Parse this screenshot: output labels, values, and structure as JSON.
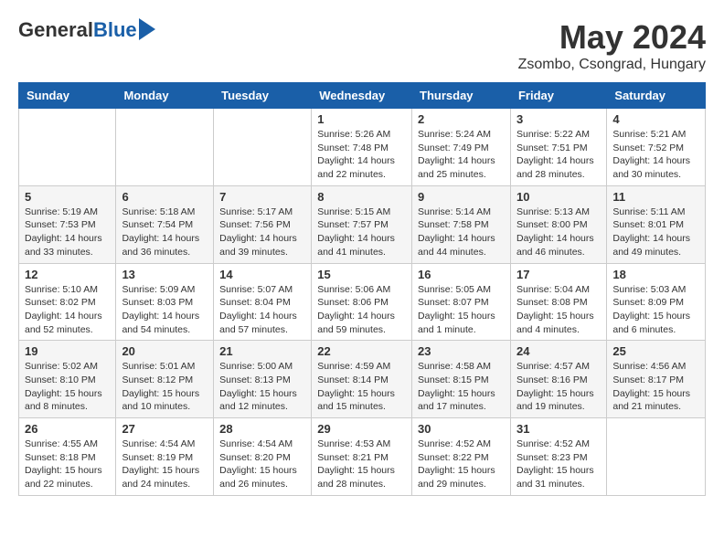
{
  "header": {
    "logo_general": "General",
    "logo_blue": "Blue",
    "month_title": "May 2024",
    "location": "Zsombo, Csongrad, Hungary"
  },
  "columns": [
    "Sunday",
    "Monday",
    "Tuesday",
    "Wednesday",
    "Thursday",
    "Friday",
    "Saturday"
  ],
  "weeks": [
    [
      {
        "day": "",
        "info": ""
      },
      {
        "day": "",
        "info": ""
      },
      {
        "day": "",
        "info": ""
      },
      {
        "day": "1",
        "info": "Sunrise: 5:26 AM\nSunset: 7:48 PM\nDaylight: 14 hours\nand 22 minutes."
      },
      {
        "day": "2",
        "info": "Sunrise: 5:24 AM\nSunset: 7:49 PM\nDaylight: 14 hours\nand 25 minutes."
      },
      {
        "day": "3",
        "info": "Sunrise: 5:22 AM\nSunset: 7:51 PM\nDaylight: 14 hours\nand 28 minutes."
      },
      {
        "day": "4",
        "info": "Sunrise: 5:21 AM\nSunset: 7:52 PM\nDaylight: 14 hours\nand 30 minutes."
      }
    ],
    [
      {
        "day": "5",
        "info": "Sunrise: 5:19 AM\nSunset: 7:53 PM\nDaylight: 14 hours\nand 33 minutes."
      },
      {
        "day": "6",
        "info": "Sunrise: 5:18 AM\nSunset: 7:54 PM\nDaylight: 14 hours\nand 36 minutes."
      },
      {
        "day": "7",
        "info": "Sunrise: 5:17 AM\nSunset: 7:56 PM\nDaylight: 14 hours\nand 39 minutes."
      },
      {
        "day": "8",
        "info": "Sunrise: 5:15 AM\nSunset: 7:57 PM\nDaylight: 14 hours\nand 41 minutes."
      },
      {
        "day": "9",
        "info": "Sunrise: 5:14 AM\nSunset: 7:58 PM\nDaylight: 14 hours\nand 44 minutes."
      },
      {
        "day": "10",
        "info": "Sunrise: 5:13 AM\nSunset: 8:00 PM\nDaylight: 14 hours\nand 46 minutes."
      },
      {
        "day": "11",
        "info": "Sunrise: 5:11 AM\nSunset: 8:01 PM\nDaylight: 14 hours\nand 49 minutes."
      }
    ],
    [
      {
        "day": "12",
        "info": "Sunrise: 5:10 AM\nSunset: 8:02 PM\nDaylight: 14 hours\nand 52 minutes."
      },
      {
        "day": "13",
        "info": "Sunrise: 5:09 AM\nSunset: 8:03 PM\nDaylight: 14 hours\nand 54 minutes."
      },
      {
        "day": "14",
        "info": "Sunrise: 5:07 AM\nSunset: 8:04 PM\nDaylight: 14 hours\nand 57 minutes."
      },
      {
        "day": "15",
        "info": "Sunrise: 5:06 AM\nSunset: 8:06 PM\nDaylight: 14 hours\nand 59 minutes."
      },
      {
        "day": "16",
        "info": "Sunrise: 5:05 AM\nSunset: 8:07 PM\nDaylight: 15 hours\nand 1 minute."
      },
      {
        "day": "17",
        "info": "Sunrise: 5:04 AM\nSunset: 8:08 PM\nDaylight: 15 hours\nand 4 minutes."
      },
      {
        "day": "18",
        "info": "Sunrise: 5:03 AM\nSunset: 8:09 PM\nDaylight: 15 hours\nand 6 minutes."
      }
    ],
    [
      {
        "day": "19",
        "info": "Sunrise: 5:02 AM\nSunset: 8:10 PM\nDaylight: 15 hours\nand 8 minutes."
      },
      {
        "day": "20",
        "info": "Sunrise: 5:01 AM\nSunset: 8:12 PM\nDaylight: 15 hours\nand 10 minutes."
      },
      {
        "day": "21",
        "info": "Sunrise: 5:00 AM\nSunset: 8:13 PM\nDaylight: 15 hours\nand 12 minutes."
      },
      {
        "day": "22",
        "info": "Sunrise: 4:59 AM\nSunset: 8:14 PM\nDaylight: 15 hours\nand 15 minutes."
      },
      {
        "day": "23",
        "info": "Sunrise: 4:58 AM\nSunset: 8:15 PM\nDaylight: 15 hours\nand 17 minutes."
      },
      {
        "day": "24",
        "info": "Sunrise: 4:57 AM\nSunset: 8:16 PM\nDaylight: 15 hours\nand 19 minutes."
      },
      {
        "day": "25",
        "info": "Sunrise: 4:56 AM\nSunset: 8:17 PM\nDaylight: 15 hours\nand 21 minutes."
      }
    ],
    [
      {
        "day": "26",
        "info": "Sunrise: 4:55 AM\nSunset: 8:18 PM\nDaylight: 15 hours\nand 22 minutes."
      },
      {
        "day": "27",
        "info": "Sunrise: 4:54 AM\nSunset: 8:19 PM\nDaylight: 15 hours\nand 24 minutes."
      },
      {
        "day": "28",
        "info": "Sunrise: 4:54 AM\nSunset: 8:20 PM\nDaylight: 15 hours\nand 26 minutes."
      },
      {
        "day": "29",
        "info": "Sunrise: 4:53 AM\nSunset: 8:21 PM\nDaylight: 15 hours\nand 28 minutes."
      },
      {
        "day": "30",
        "info": "Sunrise: 4:52 AM\nSunset: 8:22 PM\nDaylight: 15 hours\nand 29 minutes."
      },
      {
        "day": "31",
        "info": "Sunrise: 4:52 AM\nSunset: 8:23 PM\nDaylight: 15 hours\nand 31 minutes."
      },
      {
        "day": "",
        "info": ""
      }
    ]
  ]
}
